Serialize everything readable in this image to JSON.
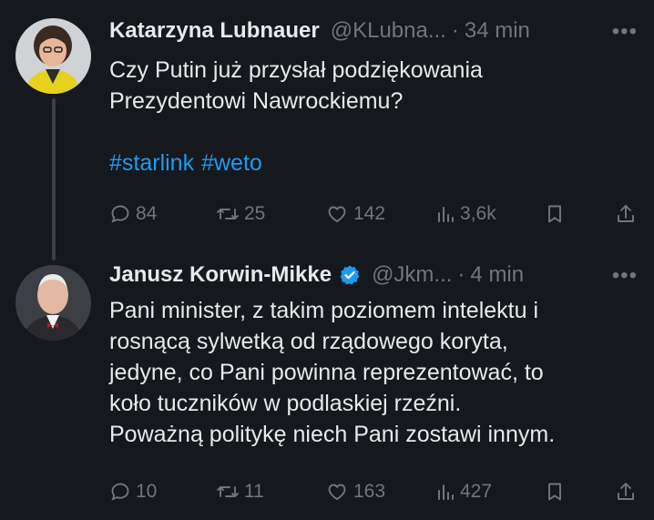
{
  "tweets": [
    {
      "author": "Katarzyna Lubnauer",
      "handle": "@KLubna...",
      "separator": "·",
      "time": "34 min",
      "more": "•••",
      "text_lines": [
        "Czy Putin już przysłał podziękowania",
        "Prezydentowi Nawrockiemu?"
      ],
      "hashtags": [
        "#starlink",
        "#weto"
      ],
      "replies": "84",
      "reposts": "25",
      "likes": "142",
      "views": "3,6k",
      "verified": false
    },
    {
      "author": "Janusz Korwin-Mikke",
      "handle": "@Jkm...",
      "separator": "·",
      "time": "4 min",
      "more": "•••",
      "text_lines": [
        "Pani minister, z takim poziomem intelektu i",
        "rosnącą sylwetką od rządowego koryta,",
        "jedyne, co Pani powinna reprezentować, to",
        "koło tuczników w podlaskiej rzeźni.",
        "Poważną politykę niech Pani zostawi innym."
      ],
      "replies": "10",
      "reposts": "11",
      "likes": "163",
      "views": "427",
      "verified": true
    }
  ],
  "colors": {
    "background": "#15181c",
    "text": "#e7e9ea",
    "muted": "#71767b",
    "link": "#1d9bf0",
    "verified": "#1d9bf0",
    "thread_line": "#3b4045"
  },
  "icons": [
    "reply-icon",
    "repost-icon",
    "like-icon",
    "views-icon",
    "bookmark-icon",
    "share-icon",
    "verified-badge-icon",
    "more-icon"
  ]
}
